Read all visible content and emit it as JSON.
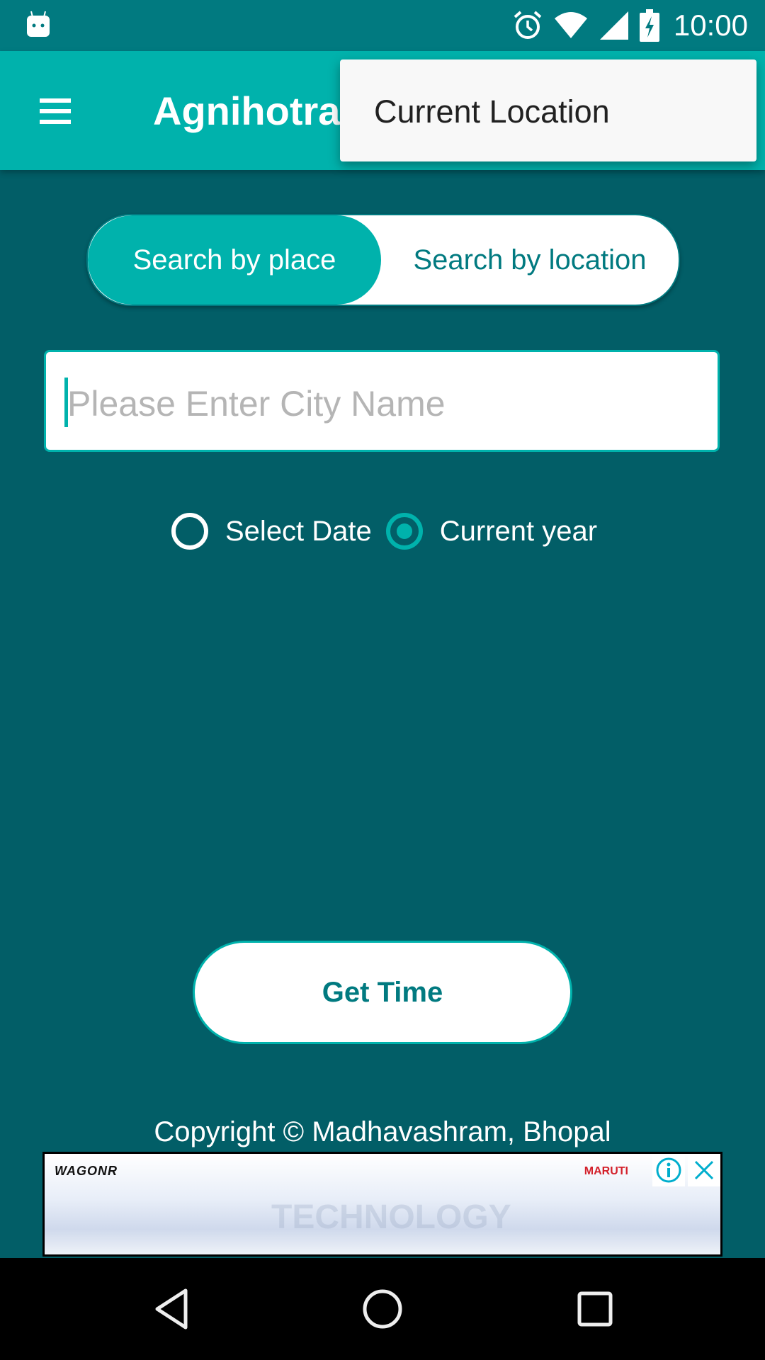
{
  "status_bar": {
    "time": "10:00",
    "icons": [
      "android-robot-icon",
      "alarm-icon",
      "wifi-icon",
      "signal-icon",
      "battery-charging-icon"
    ]
  },
  "app_bar": {
    "menu_icon": "hamburger-menu-icon",
    "title": "Agnihotra"
  },
  "popup_menu": {
    "items": [
      {
        "label": "Current Location"
      }
    ]
  },
  "search_toggle": {
    "options": [
      {
        "label": "Search by place",
        "selected": true
      },
      {
        "label": "Search by location",
        "selected": false
      }
    ]
  },
  "city_input": {
    "value": "",
    "placeholder": "Please Enter City Name"
  },
  "date_mode": {
    "options": [
      {
        "label": "Select Date",
        "checked": false
      },
      {
        "label": "Current year",
        "checked": true
      }
    ]
  },
  "get_time_button": {
    "label": "Get Time"
  },
  "footer": {
    "copyright": "Copyright © Madhavashram, Bhopal"
  },
  "ad_banner": {
    "brand": "WAGONR",
    "maker": "MARUTI",
    "tagline": "TECHNOLOGY",
    "info_icon": "info-icon",
    "close_icon": "close-icon"
  },
  "nav_bar": {
    "buttons": [
      "back-icon",
      "home-icon",
      "recents-icon"
    ]
  },
  "colors": {
    "background": "#025E67",
    "status_bar": "#017A80",
    "accent": "#00B2AC",
    "accent_text": "#017A80"
  }
}
